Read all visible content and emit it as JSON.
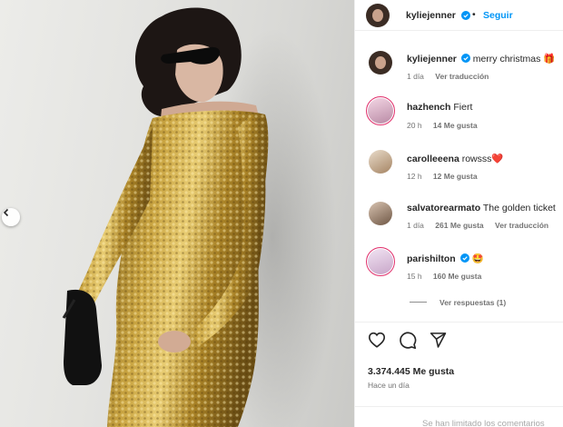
{
  "header": {
    "username": "kyliejenner",
    "follow_label": "Seguir"
  },
  "caption": {
    "username": "kyliejenner",
    "text": "merry christmas 🎁",
    "time": "1 día",
    "translate": "Ver traducción"
  },
  "comments": [
    {
      "username": "hazhench",
      "text": "Fiert",
      "time": "20 h",
      "likes": "14 Me gusta",
      "translate": ""
    },
    {
      "username": "carolleeena",
      "text": "rowsss❤️",
      "time": "12 h",
      "likes": "12 Me gusta",
      "translate": ""
    },
    {
      "username": "salvatorearmato",
      "text": "The golden ticket",
      "time": "1 día",
      "likes": "261 Me gusta",
      "translate": "Ver traducción"
    },
    {
      "username": "parishilton",
      "text": "🤩",
      "time": "15 h",
      "likes": "160 Me gusta",
      "translate": ""
    }
  ],
  "view_replies": "Ver respuestas (1)",
  "likes_count": "3.374.445 Me gusta",
  "posted_ago": "Hace un día",
  "comments_limited": "Se han limitado los comentarios",
  "colors": {
    "accent": "#0095f6",
    "verified": "#0095f6",
    "story_ring": "#e1306c",
    "dress_gold": "#b8922e"
  },
  "icons": {
    "like": "heart-outline-icon",
    "comment": "comment-bubble-icon",
    "share": "paper-plane-icon",
    "prev": "chevron-left-icon",
    "verified": "verified-badge-icon"
  }
}
